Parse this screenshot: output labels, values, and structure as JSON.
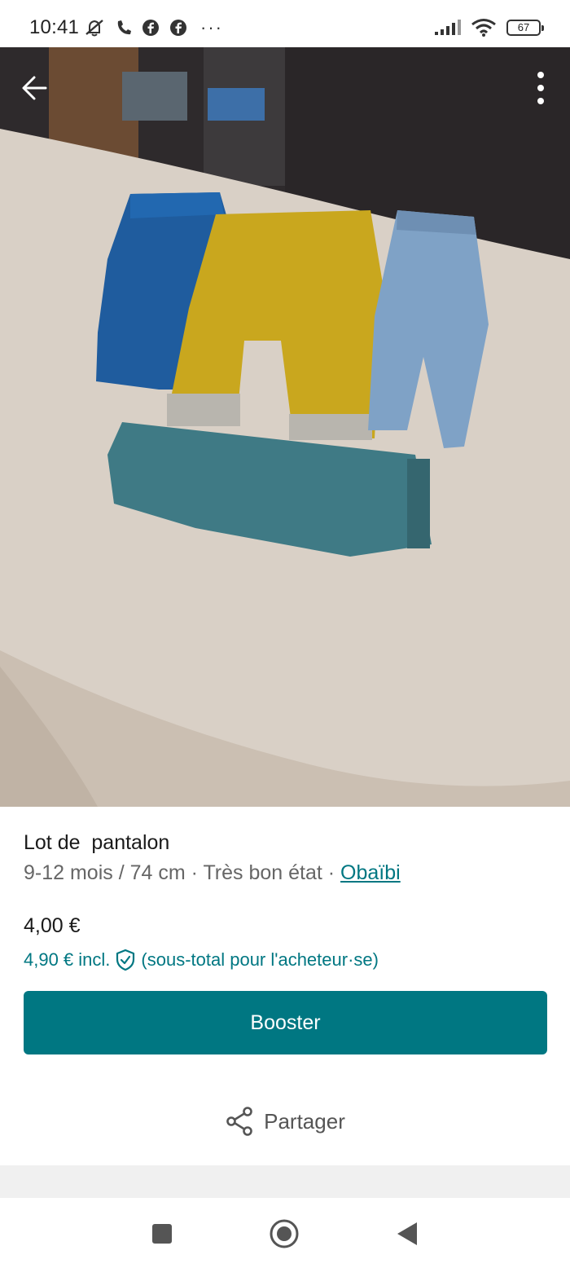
{
  "status_bar": {
    "time": "10:41",
    "battery": "67",
    "icons": [
      "mute-icon",
      "phone-icon",
      "facebook-icon",
      "facebook-icon",
      "more-dots-icon",
      "signal-icon",
      "wifi-icon",
      "battery-icon"
    ],
    "dots": "···"
  },
  "photo": {
    "icons": {
      "back": "arrow-left-icon",
      "menu": "more-vertical-icon"
    }
  },
  "item": {
    "title": "Lot de  pantalon",
    "size": "9-12 mois / 74 cm",
    "separator1": " · ",
    "condition": "Très bon état",
    "separator2": " · ",
    "brand": "Obaïbi"
  },
  "pricing": {
    "price": "4,00 €",
    "price_incl": "4,90 € incl.",
    "protection_note": "(sous-total pour l'acheteur·se)",
    "icon": "shield-check-icon"
  },
  "actions": {
    "booster_label": "Booster",
    "share_label": "Partager",
    "share_icon": "share-icon"
  },
  "colors": {
    "accent": "#007782",
    "text_primary": "#1a1a1a",
    "text_secondary": "#666666"
  },
  "navbar": {
    "icons": [
      "square-icon",
      "home-circle-icon",
      "back-triangle-icon"
    ]
  }
}
